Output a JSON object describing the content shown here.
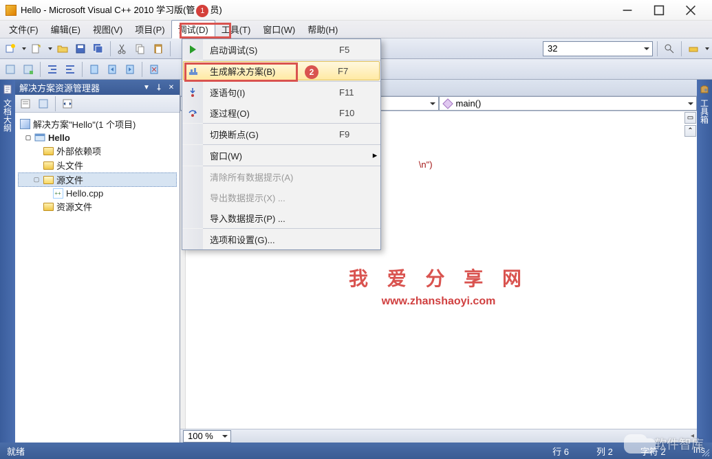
{
  "title": {
    "prefix": "Hello - Microsoft Visual C++ 2010 学习版(管",
    "suffix": "员)",
    "marker": "1"
  },
  "menu": {
    "file": "文件(F)",
    "edit": "编辑(E)",
    "view": "视图(V)",
    "project": "项目(P)",
    "debug": "调试(D)",
    "tools": "工具(T)",
    "window": "窗口(W)",
    "help": "帮助(H)"
  },
  "annot2": "2",
  "dropdown": {
    "startDebug": "启动调试(S)",
    "startDebug_sc": "F5",
    "build": "生成解决方案(B)",
    "build_sc": "F7",
    "stepInto": "逐语句(I)",
    "stepInto_sc": "F11",
    "stepOver": "逐过程(O)",
    "stepOver_sc": "F10",
    "toggleBp": "切换断点(G)",
    "toggleBp_sc": "F9",
    "windows": "窗口(W)",
    "clearTips": "清除所有数据提示(A)",
    "exportTips": "导出数据提示(X) ...",
    "importTips": "导入数据提示(P) ...",
    "options": "选项和设置(G)..."
  },
  "toolbar": {
    "combo_right": "32",
    "zoom": "100 %"
  },
  "panel": {
    "title": "解决方案资源管理器",
    "solution": "解决方案\"Hello\"(1 个项目)",
    "project": "Hello",
    "extDeps": "外部依赖项",
    "headers": "头文件",
    "sources": "源文件",
    "cpp": "Hello.cpp",
    "resources": "资源文件"
  },
  "leftrail": "文档大纲",
  "rightrail": "工具箱",
  "editor": {
    "scope_right": "main()",
    "visible_str": "\\n\")",
    "watermark1": "我 爱 分 享 网",
    "watermark2": "www.zhanshaoyi.com"
  },
  "status": {
    "ready": "就绪",
    "line": "行 6",
    "col": "列 2",
    "char": "字符 2",
    "ins": "Ins"
  },
  "wechat": "软件智库"
}
